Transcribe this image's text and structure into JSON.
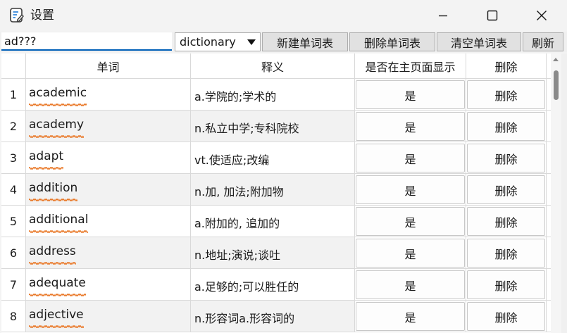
{
  "window": {
    "title": "设置"
  },
  "toolbar": {
    "search_value": "ad???",
    "dictionary_selected": "dictionary",
    "new_list_label": "新建单词表",
    "delete_list_label": "删除单词表",
    "clear_list_label": "清空单词表",
    "refresh_label": "刷新"
  },
  "table": {
    "headers": {
      "word": "单词",
      "definition": "释义",
      "show_on_main": "是否在主页面显示",
      "delete": "删除"
    },
    "rows": [
      {
        "num": "1",
        "word": "academic",
        "definition": "a.学院的;学术的",
        "show": "是",
        "delete": "删除"
      },
      {
        "num": "2",
        "word": "academy",
        "definition": "n.私立中学;专科院校",
        "show": "是",
        "delete": "删除"
      },
      {
        "num": "3",
        "word": "adapt",
        "definition": "vt.使适应;改编",
        "show": "是",
        "delete": "删除"
      },
      {
        "num": "4",
        "word": "addition",
        "definition": "n.加, 加法;附加物",
        "show": "是",
        "delete": "删除"
      },
      {
        "num": "5",
        "word": "additional",
        "definition": "a.附加的, 追加的",
        "show": "是",
        "delete": "删除"
      },
      {
        "num": "6",
        "word": "address",
        "definition": "n.地址;演说;谈吐",
        "show": "是",
        "delete": "删除"
      },
      {
        "num": "7",
        "word": "adequate",
        "definition": "a.足够的;可以胜任的",
        "show": "是",
        "delete": "删除"
      },
      {
        "num": "8",
        "word": "adjective",
        "definition": "n.形容词a.形容词的",
        "show": "是",
        "delete": "删除"
      }
    ]
  },
  "colors": {
    "accent": "#005fb8",
    "spellcheck_underline": "#e8711c",
    "button_bg": "#e1e1e1",
    "alt_row_bg": "#f2f2f2"
  },
  "icons": {
    "app": "notepad-pen-icon",
    "minimize": "minimize-icon",
    "maximize": "maximize-icon",
    "close": "close-icon",
    "dropdown": "triangle-down-icon"
  }
}
